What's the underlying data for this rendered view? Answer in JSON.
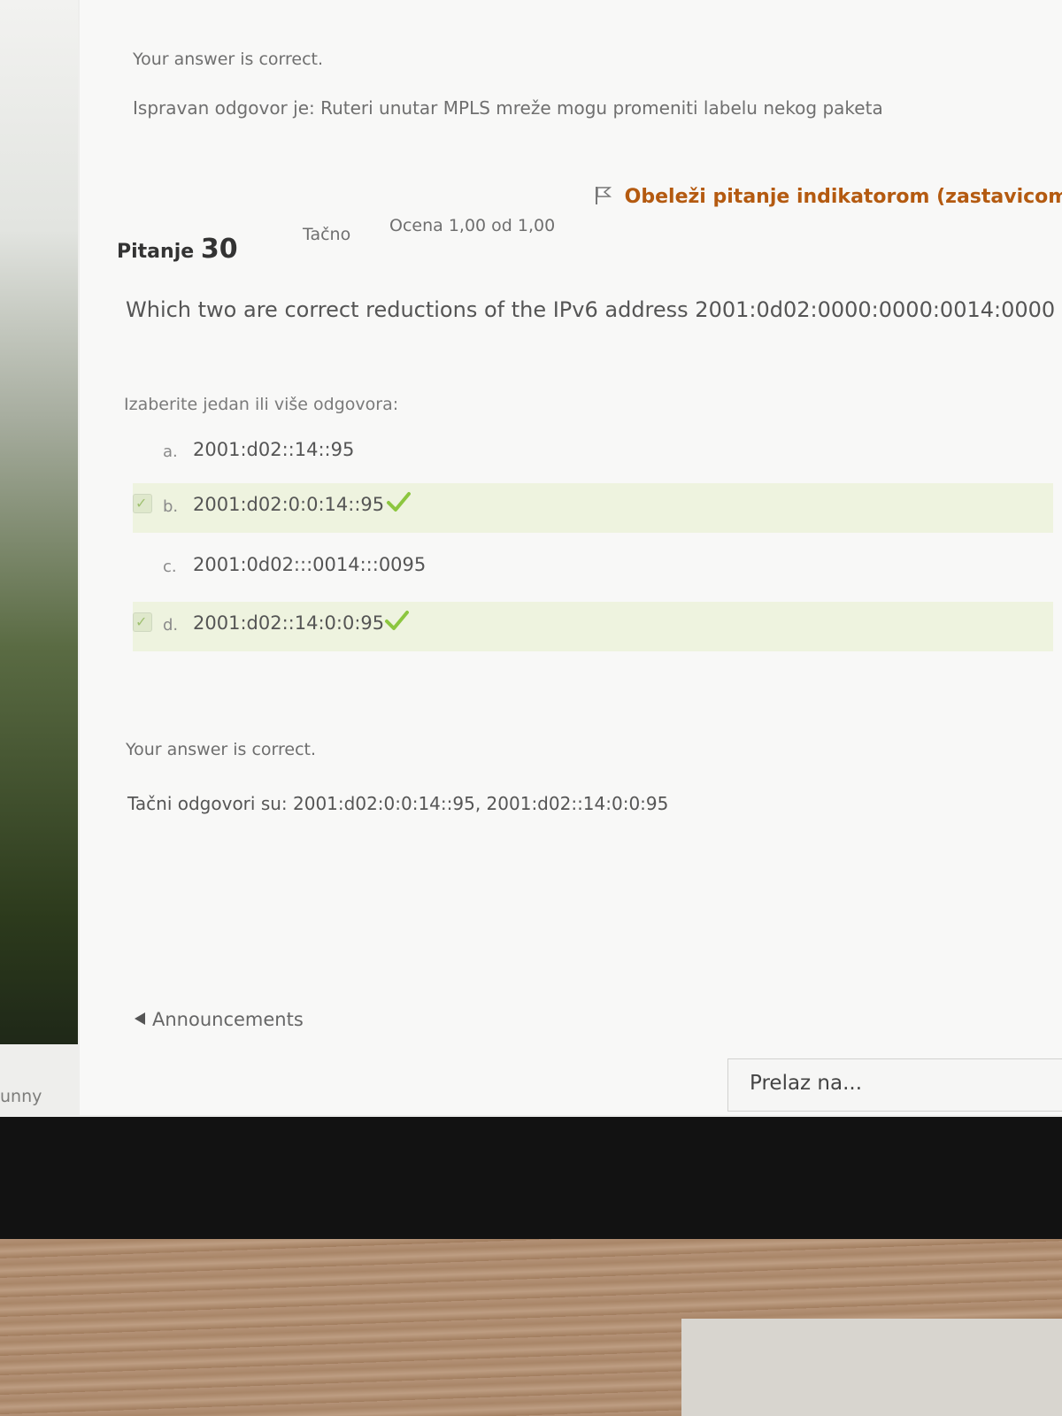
{
  "sidebar_fragment": "unny",
  "feedback_top": {
    "correct": "Your answer is correct.",
    "right_answer": "Ispravan odgovor je: Ruteri unutar MPLS mreže mogu promeniti labelu nekog paketa"
  },
  "question": {
    "label": "Pitanje",
    "number": "30",
    "state": "Tačno",
    "grade": "Ocena 1,00 od 1,00",
    "flag_label": "Obeleži pitanje indikatorom (zastavicom",
    "text": "Which two are correct reductions of the IPv6 address 2001:0d02:0000:0000:0014:0000",
    "prompt": "Izaberite jedan ili više odgovora:",
    "options": [
      {
        "letter": "a.",
        "text": "2001:d02::14::95",
        "selected": false,
        "correct": false
      },
      {
        "letter": "b.",
        "text": "2001:d02:0:0:14::95",
        "selected": true,
        "correct": true
      },
      {
        "letter": "c.",
        "text": "2001:0d02:::0014:::0095",
        "selected": false,
        "correct": false
      },
      {
        "letter": "d.",
        "text": "2001:d02::14:0:0:95",
        "selected": true,
        "correct": true
      }
    ]
  },
  "feedback_bottom": {
    "correct": "Your answer is correct.",
    "right_answers": "Tačni odgovori su: 2001:d02:0:0:14::95, 2001:d02::14:0:0:95"
  },
  "navigation": {
    "prev_label": "Announcements",
    "jump_label": "Prelaz na..."
  },
  "colors": {
    "flag_text": "#b45a10",
    "correct_highlight": "#eef3df",
    "check_green": "#8cc63f"
  },
  "icons": [
    "flag-icon",
    "checkmark-icon",
    "triangle-left-icon"
  ]
}
